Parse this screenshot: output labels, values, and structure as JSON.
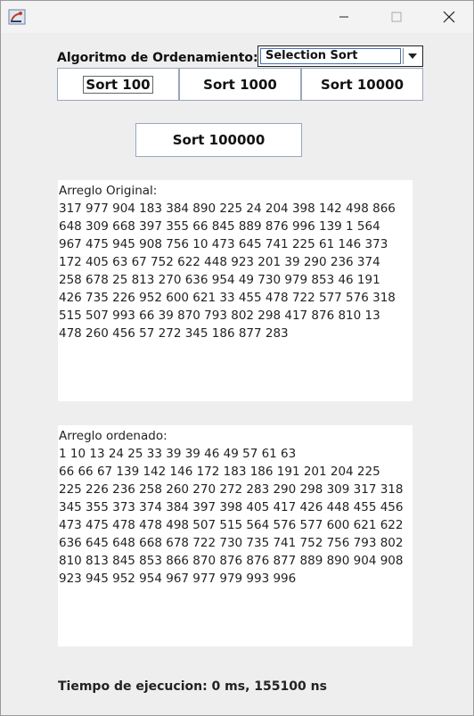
{
  "window": {
    "title": ""
  },
  "controls": {
    "algorithm_label": "Algoritmo de Ordenamiento:",
    "algorithm_selected": "Selection Sort",
    "buttons": [
      "Sort 100",
      "Sort 1000",
      "Sort 10000",
      "Sort 100000"
    ]
  },
  "original": {
    "lines": [
      "Arreglo Original:",
      "317 977 904 183 384 890 225 24 204 398 142 498 866",
      "648 309 668 397 355 66 845 889 876 996 139 1 564",
      "967 475 945 908 756 10 473 645 741 225 61 146 373",
      "172 405 63 67 752 622 448 923 201 39 290 236 374",
      "258 678 25 813 270 636 954 49 730 979 853 46 191",
      "426 735 226 952 600 621 33 455 478 722 577 576 318",
      "515 507 993 66 39 870 793 802 298 417 876 810 13",
      "478 260 456 57 272 345 186 877 283"
    ]
  },
  "sorted": {
    "lines": [
      "Arreglo ordenado:",
      "1 10 13 24 25 33 39 39 46 49 57 61 63",
      "66 66 67 139 142 146 172 183 186 191 201 204 225",
      "225 226 236 258 260 270 272 283 290 298 309 317 318",
      "345 355 373 374 384 397 398 405 417 426 448 455 456",
      "473 475 478 478 498 507 515 564 576 577 600 621 622",
      "636 645 648 668 678 722 730 735 741 752 756 793 802",
      "810 813 845 853 866 870 876 876 877 889 890 904 908",
      "923 945 952 954 967 977 979 993 996"
    ]
  },
  "status": {
    "text": "Tiempo de ejecucion: 0 ms, 155100 ns"
  }
}
